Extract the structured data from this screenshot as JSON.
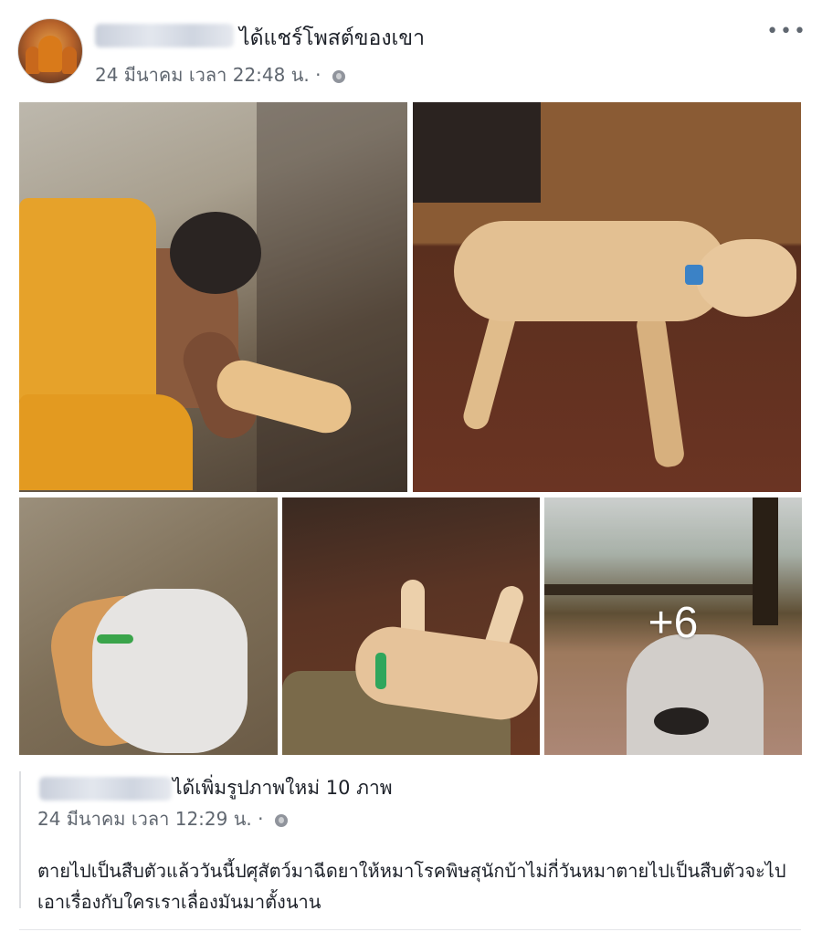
{
  "post": {
    "action_text": "ได้แชร์โพสต์ของเขา",
    "date": "24 มีนาคม เวลา 22:48 น.",
    "separator": "·",
    "privacy_icon": "globe-icon",
    "more_icon": "ellipsis-icon",
    "more_label": "•••"
  },
  "photos": {
    "overflow_label": "+6"
  },
  "shared_post": {
    "action_text": "ได้เพิ่มรูปภาพใหม่ 10 ภาพ",
    "date": "24 มีนาคม เวลา 12:29 น.",
    "separator": "·",
    "privacy_icon": "globe-icon",
    "body": "ตายไปเป็นสืบตัวแล้ววันนี้ปศุสัตว์มาฉีดยาให้หมาโรคพิษสุนักบ้าไม่กี่วันหมาตายไปเป็นสืบตัวจะไปเอาเรื่องกับใครเราเลื่องมันมาตั้งนาน"
  }
}
